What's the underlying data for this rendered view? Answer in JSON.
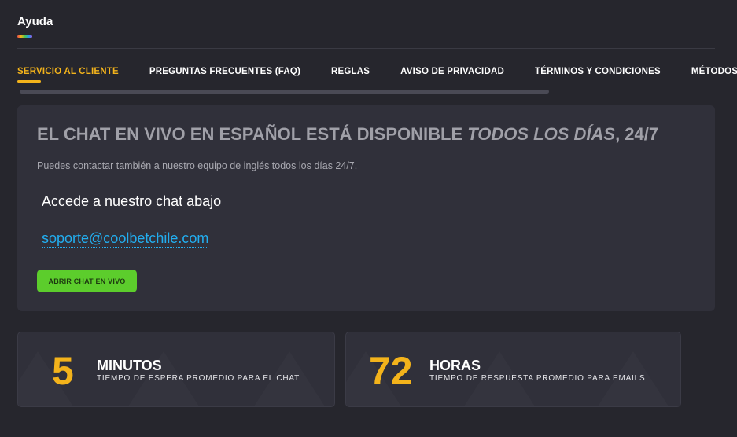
{
  "header": {
    "title": "Ayuda"
  },
  "tabs": [
    {
      "label": "SERVICIO AL CLIENTE",
      "active": true
    },
    {
      "label": "PREGUNTAS FRECUENTES (FAQ)",
      "active": false
    },
    {
      "label": "REGLAS",
      "active": false
    },
    {
      "label": "AVISO DE PRIVACIDAD",
      "active": false
    },
    {
      "label": "TÉRMINOS Y CONDICIONES",
      "active": false
    },
    {
      "label": "MÉTODOS",
      "active": false
    }
  ],
  "chat": {
    "heading_main": "EL CHAT EN VIVO EN ESPAÑOL ESTÁ DISPONIBLE ",
    "heading_emphasis": "TODOS LOS DÍAS",
    "heading_suffix": ", 24/7",
    "subtitle": "Puedes contactar también a nuestro equipo de inglés todos los días 24/7.",
    "access_text": "Accede a nuestro chat abajo",
    "email": "soporte@coolbetchile.com",
    "button_label": "ABRIR CHAT EN VIVO"
  },
  "stats": [
    {
      "number": "5",
      "unit": "MINUTOS",
      "description": "TIEMPO DE ESPERA PROMEDIO PARA EL CHAT"
    },
    {
      "number": "72",
      "unit": "HORAS",
      "description": "TIEMPO DE RESPUESTA PROMEDIO PARA EMAILS"
    }
  ],
  "colors": {
    "accent": "#f3b31b",
    "button": "#5ccd2c",
    "link": "#22aef0",
    "background": "#26262d",
    "card": "#30303a"
  }
}
